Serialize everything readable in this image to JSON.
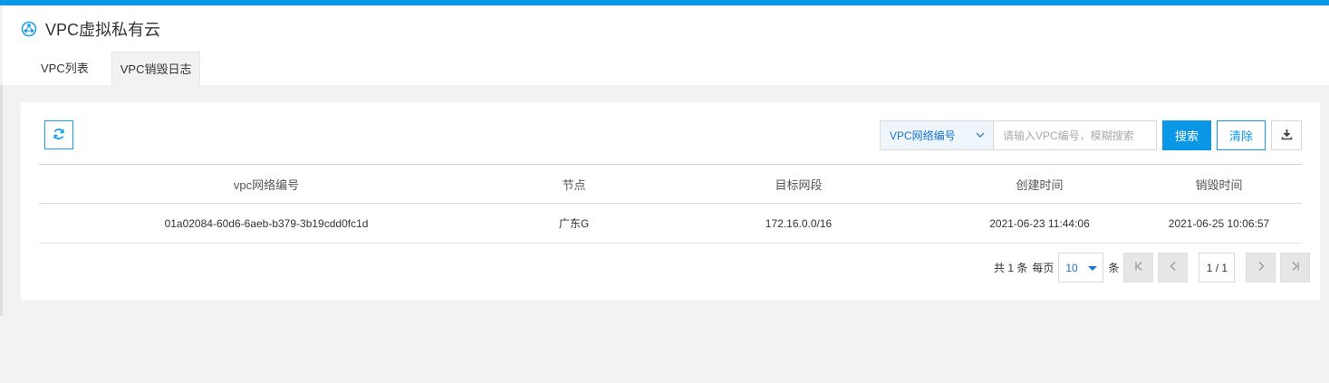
{
  "header": {
    "title": "VPC虚拟私有云",
    "tabs": [
      {
        "label": "VPC列表",
        "active": false
      },
      {
        "label": "VPC销毁日志",
        "active": true
      }
    ]
  },
  "toolbar": {
    "refresh_icon": "refresh-icon",
    "search_field": "VPC网络编号",
    "search_placeholder": "请输入VPC编号，模糊搜索",
    "search_label": "搜索",
    "clear_label": "清除",
    "download_icon": "download-icon"
  },
  "table": {
    "columns": [
      "vpc网络编号",
      "节点",
      "目标网段",
      "创建时间",
      "销毁时间"
    ],
    "rows": [
      [
        "01a02084-60d6-6aeb-b379-3b19cdd0fc1d",
        "广东G",
        "172.16.0.0/16",
        "2021-06-23 11:44:06",
        "2021-06-25 10:06:57"
      ]
    ]
  },
  "pager": {
    "total_text": "共 1 条",
    "per_page_label": "每页",
    "page_size": "10",
    "unit_label": "条",
    "page_indicator": "1 / 1"
  },
  "colors": {
    "accent": "#0a98e6",
    "link": "#1a73c8"
  }
}
